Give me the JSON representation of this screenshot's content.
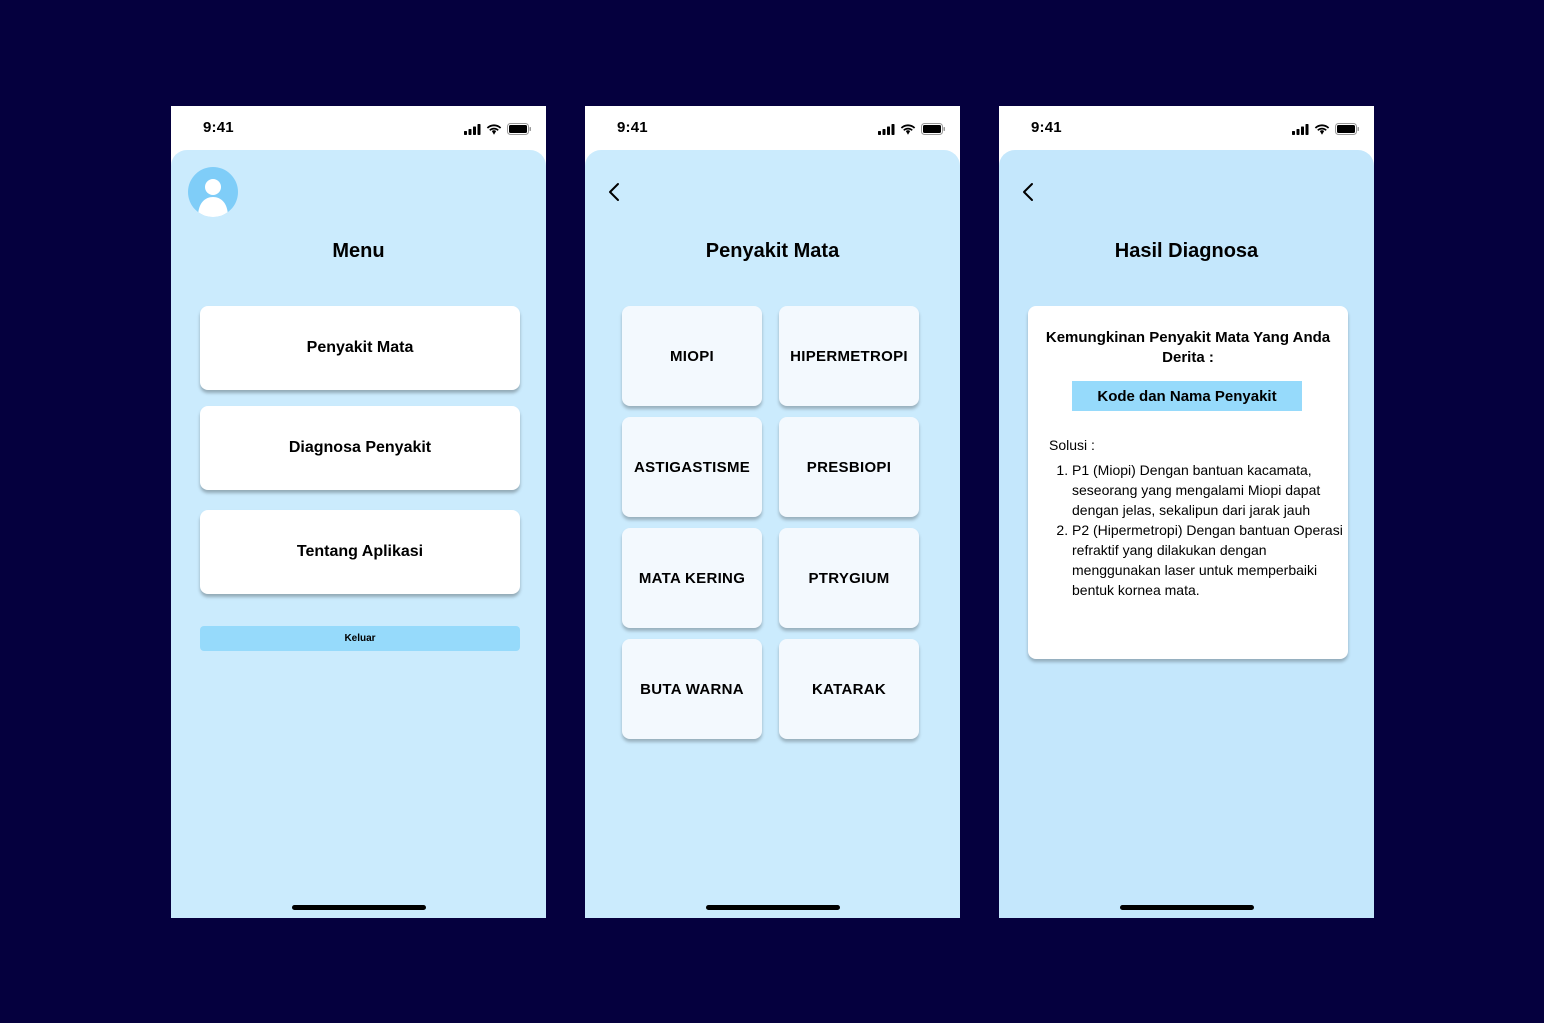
{
  "status": {
    "time": "9:41"
  },
  "menu_screen": {
    "title": "Menu",
    "items": [
      {
        "label": "Penyakit Mata"
      },
      {
        "label": "Diagnosa Penyakit"
      },
      {
        "label": "Tentang Aplikasi"
      }
    ],
    "logout_label": "Keluar"
  },
  "disease_screen": {
    "title": "Penyakit Mata",
    "diseases": [
      "MIOPI",
      "HIPERMETROPI",
      "ASTIGASTISME",
      "PRESBIOPI",
      "MATA KERING",
      "PTRYGIUM",
      "BUTA WARNA",
      "KATARAK"
    ]
  },
  "result_screen": {
    "title": "Hasil Diagnosa",
    "heading": "Kemungkinan Penyakit Mata Yang Anda Derita :",
    "code_label": "Kode dan Nama Penyakit",
    "solusi_label": "Solusi :",
    "solutions": [
      "P1 (Miopi) Dengan bantuan kacamata, seseorang yang mengalami Miopi dapat dengan jelas, sekalipun dari jarak jauh",
      "P2 (Hipermetropi) Dengan bantuan Operasi refraktif yang dilakukan dengan menggunakan laser untuk memperbaiki bentuk kornea mata."
    ]
  },
  "colors": {
    "background": "#05003e",
    "screen_bg": "#cbebfd",
    "accent": "#96dafb",
    "avatar": "#7fcdf8"
  }
}
